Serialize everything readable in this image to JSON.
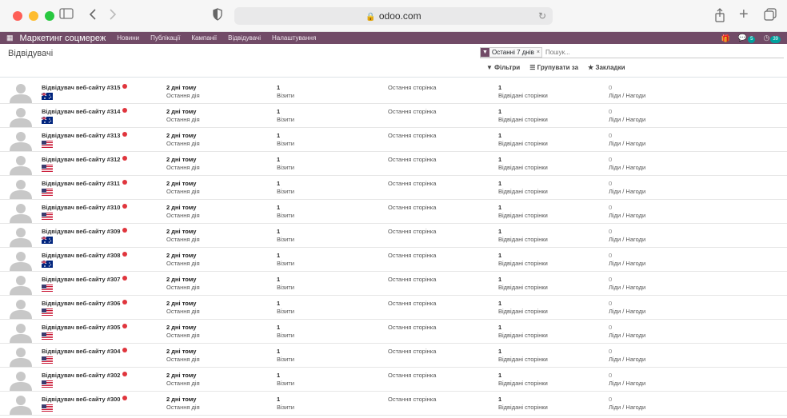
{
  "browser": {
    "url": "odoo.com"
  },
  "navbar": {
    "brand": "Маркетинг соцмереж",
    "menu": [
      "Новини",
      "Публікації",
      "Кампанії",
      "Відвідувачі",
      "Налаштування"
    ],
    "badges": {
      "messages": "5",
      "activities": "39"
    }
  },
  "control_panel": {
    "breadcrumb": "Відвідувачі",
    "facet": "Останні 7 днів",
    "search_placeholder": "Пошук...",
    "filters_label": "Фільтри",
    "group_label": "Групувати за",
    "favorites_label": "Закладки"
  },
  "labels": {
    "last_action": "Остання дія",
    "visits": "Візити",
    "last_page": "Остання сторінка",
    "visited_pages": "Відвідані сторінки",
    "leads": "Ліди / Нагоди"
  },
  "colors": {
    "navbar": "#714b67",
    "online_dot": "#e0353d"
  },
  "visitors": [
    {
      "name": "Відвідувач веб-сайту #315",
      "flag": "au",
      "when": "2 дні тому",
      "visits": "1",
      "pages": "1",
      "leads": "0"
    },
    {
      "name": "Відвідувач веб-сайту #314",
      "flag": "au",
      "when": "2 дні тому",
      "visits": "1",
      "pages": "1",
      "leads": "0"
    },
    {
      "name": "Відвідувач веб-сайту #313",
      "flag": "us",
      "when": "2 дні тому",
      "visits": "1",
      "pages": "1",
      "leads": "0"
    },
    {
      "name": "Відвідувач веб-сайту #312",
      "flag": "us",
      "when": "2 дні тому",
      "visits": "1",
      "pages": "1",
      "leads": "0"
    },
    {
      "name": "Відвідувач веб-сайту #311",
      "flag": "us",
      "when": "2 дні тому",
      "visits": "1",
      "pages": "1",
      "leads": "0"
    },
    {
      "name": "Відвідувач веб-сайту #310",
      "flag": "us",
      "when": "2 дні тому",
      "visits": "1",
      "pages": "1",
      "leads": "0"
    },
    {
      "name": "Відвідувач веб-сайту #309",
      "flag": "au",
      "when": "2 дні тому",
      "visits": "1",
      "pages": "1",
      "leads": "0"
    },
    {
      "name": "Відвідувач веб-сайту #308",
      "flag": "au",
      "when": "2 дні тому",
      "visits": "1",
      "pages": "1",
      "leads": "0"
    },
    {
      "name": "Відвідувач веб-сайту #307",
      "flag": "us",
      "when": "2 дні тому",
      "visits": "1",
      "pages": "1",
      "leads": "0"
    },
    {
      "name": "Відвідувач веб-сайту #306",
      "flag": "us",
      "when": "2 дні тому",
      "visits": "1",
      "pages": "1",
      "leads": "0"
    },
    {
      "name": "Відвідувач веб-сайту #305",
      "flag": "us",
      "when": "2 дні тому",
      "visits": "1",
      "pages": "1",
      "leads": "0"
    },
    {
      "name": "Відвідувач веб-сайту #304",
      "flag": "us",
      "when": "2 дні тому",
      "visits": "1",
      "pages": "1",
      "leads": "0"
    },
    {
      "name": "Відвідувач веб-сайту #302",
      "flag": "us",
      "when": "2 дні тому",
      "visits": "1",
      "pages": "1",
      "leads": "0"
    },
    {
      "name": "Відвідувач веб-сайту #300",
      "flag": "us",
      "when": "2 дні тому",
      "visits": "1",
      "pages": "1",
      "leads": "0"
    }
  ]
}
